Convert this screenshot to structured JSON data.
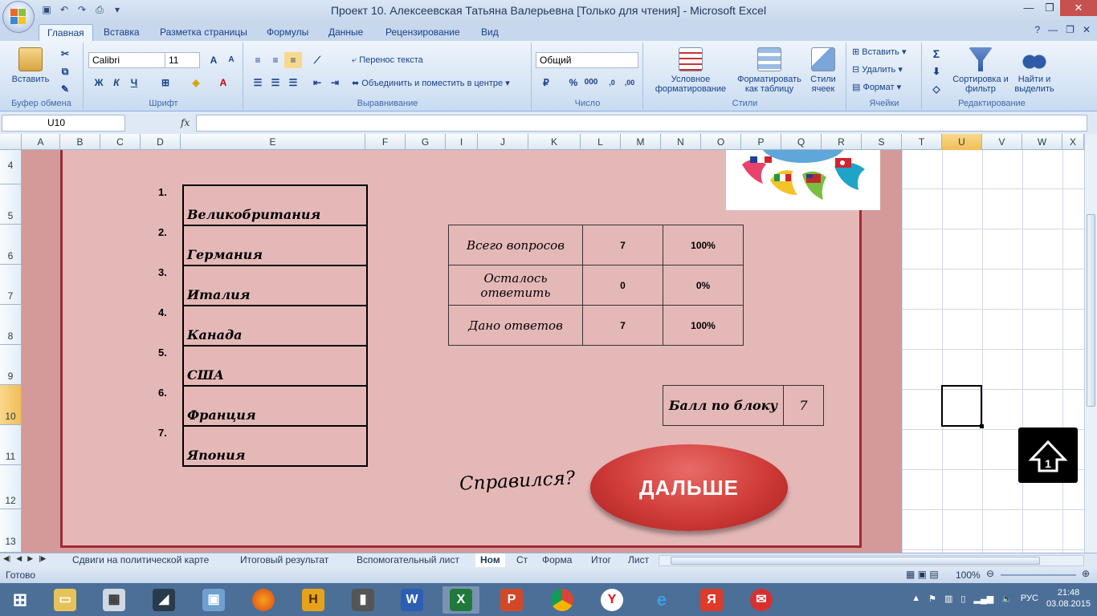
{
  "window": {
    "title": "Проект 10. Алексеевская Татьяна Валерьевна  [Только для чтения] - Microsoft Excel"
  },
  "ribbon_tabs": [
    "Главная",
    "Вставка",
    "Разметка страницы",
    "Формулы",
    "Данные",
    "Рецензирование",
    "Вид"
  ],
  "ribbon": {
    "clipboard": {
      "paste": "Вставить",
      "label": "Буфер обмена"
    },
    "font": {
      "name": "Calibri",
      "size": "11",
      "bold": "Ж",
      "italic": "К",
      "underline": "Ч",
      "label": "Шрифт"
    },
    "alignment": {
      "wrap": "Перенос текста",
      "merge": "Объединить и поместить в центре",
      "label": "Выравнивание"
    },
    "number": {
      "format": "Общий",
      "percent": "%",
      "thousands": "000",
      "label": "Число"
    },
    "styles": {
      "conditional": "Условное форматирование",
      "as_table": "Форматировать как таблицу",
      "cell_styles": "Стили ячеек",
      "label": "Стили"
    },
    "cells": {
      "insert": "Вставить",
      "delete": "Удалить",
      "format": "Формат",
      "label": "Ячейки"
    },
    "editing": {
      "sort": "Сортировка и фильтр",
      "find": "Найти и выделить",
      "label": "Редактирование"
    }
  },
  "formula_bar": {
    "name_box": "U10",
    "fx": "fx",
    "value": ""
  },
  "columns": [
    "A",
    "B",
    "C",
    "D",
    "E",
    "F",
    "G",
    "I",
    "J",
    "K",
    "L",
    "M",
    "N",
    "O",
    "P",
    "Q",
    "R",
    "S",
    "T",
    "U",
    "V",
    "W",
    "X"
  ],
  "rows": [
    "4",
    "5",
    "6",
    "7",
    "8",
    "9",
    "10",
    "11",
    "12",
    "13"
  ],
  "selected_cell": {
    "column": "U",
    "row": "10"
  },
  "countries": [
    {
      "num": "1.",
      "name": "Великобритания"
    },
    {
      "num": "2.",
      "name": "Германия"
    },
    {
      "num": "3.",
      "name": "Италия"
    },
    {
      "num": "4.",
      "name": "Канада"
    },
    {
      "num": "5.",
      "name": "США"
    },
    {
      "num": "6.",
      "name": "Франция"
    },
    {
      "num": "7.",
      "name": "Япония"
    }
  ],
  "stats": [
    {
      "label": "Всего вопросов",
      "count": "7",
      "percent": "100%"
    },
    {
      "label": "Осталось ответить",
      "count": "0",
      "percent": "0%"
    },
    {
      "label": "Дано ответов",
      "count": "7",
      "percent": "100%"
    }
  ],
  "score": {
    "label": "Балл по блоку",
    "value": "7"
  },
  "question_text": "Справился?",
  "next_button": "ДАЛЬШЕ",
  "sheet_tabs": [
    "Сдвиги на политической карте",
    "Итоговый результат",
    "Вспомогательный лист",
    "Ном",
    "Ст",
    "Форма",
    "Итог",
    "Лист"
  ],
  "active_sheet_tab": "Ном",
  "status": {
    "ready": "Готово",
    "zoom": "100%"
  },
  "taskbar": {
    "lang": "РУС",
    "time": "21:48",
    "date": "03.08.2015"
  }
}
